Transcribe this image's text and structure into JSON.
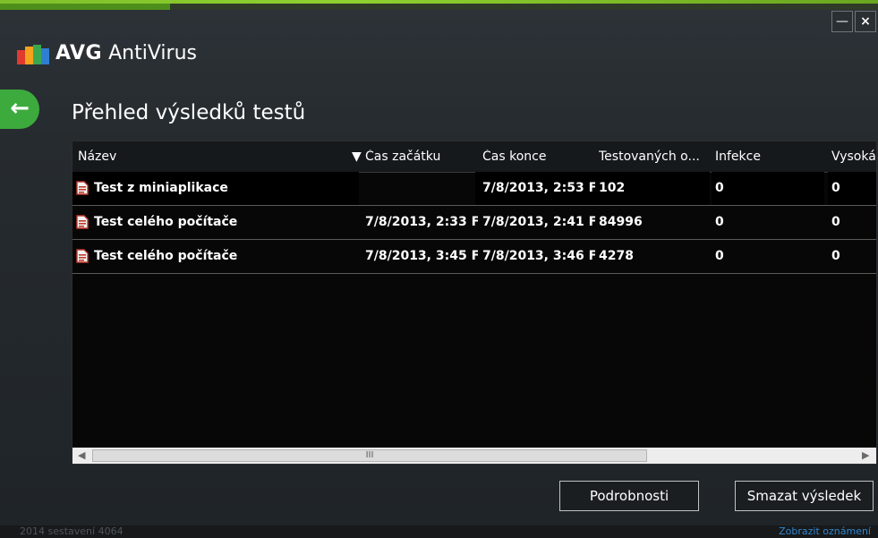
{
  "app": {
    "brand_logo_text": "AVG",
    "brand_product": "AntiVirus"
  },
  "window": {
    "minimize_glyph": "—",
    "close_glyph": "×"
  },
  "nav": {
    "back_icon": "back-arrow-icon"
  },
  "page": {
    "title": "Přehled výsledků testů"
  },
  "table": {
    "columns": [
      "Název",
      "Čas začátku",
      "Čas konce",
      "Testovaných o...",
      "Infekce",
      "Vysoká"
    ],
    "sort_indicator": "▼",
    "rows": [
      {
        "name": "Test z miniaplikace",
        "start": "",
        "end": "7/8/2013, 2:53 F",
        "tested": "102",
        "infections": "0",
        "high": "0"
      },
      {
        "name": "Test celého počítače",
        "start": "7/8/2013, 2:33 F",
        "end": "7/8/2013, 2:41 F",
        "tested": "84996",
        "infections": "0",
        "high": "0"
      },
      {
        "name": "Test celého počítače",
        "start": "7/8/2013, 3:45 F",
        "end": "7/8/2013, 3:46 F",
        "tested": "4278",
        "infections": "0",
        "high": "0"
      }
    ],
    "scroll_left": "◀",
    "scroll_right": "▶",
    "scroll_grip": "III"
  },
  "buttons": {
    "details": "Podrobnosti",
    "delete": "Smazat výsledek"
  },
  "footer": {
    "build": "2014 sestavení 4064",
    "notifications": "Zobrazit oznámení"
  },
  "colors": {
    "accent_green": "#3daa3d",
    "link_blue": "#2f86cf",
    "background": "#1e2327"
  }
}
